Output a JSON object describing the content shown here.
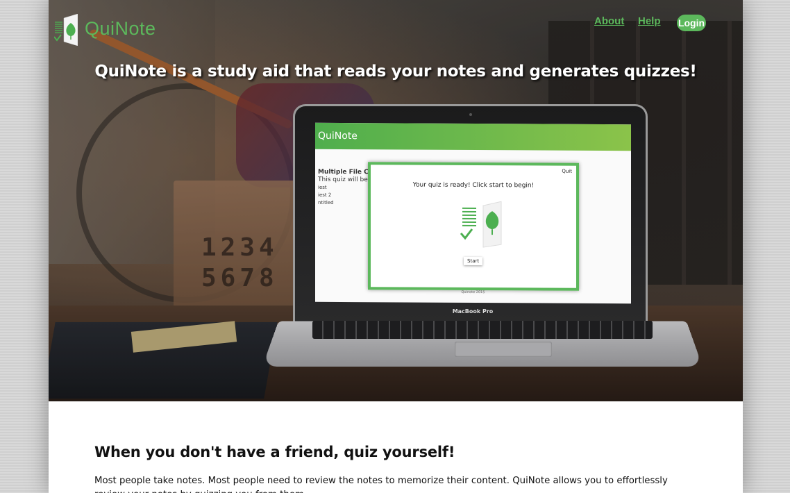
{
  "header": {
    "logo_text": "QuiNote",
    "nav": {
      "about": "About",
      "help": "Help",
      "login": "Login"
    }
  },
  "hero": {
    "headline": "QuiNote is a study aid that reads your notes and generates quizzes!",
    "crate_numbers": "1234\n5678",
    "laptop_brand": "MacBook Pro",
    "screen": {
      "app_title": "QuiNote",
      "left_text_1": "Multiple File C",
      "left_text_2": "This quiz will be",
      "left_text_3": "iest",
      "left_text_4": "iest 2",
      "left_text_5": "ntitled",
      "modal_quit": "Quit",
      "modal_message": "Your quiz is ready! Click start to begin!",
      "modal_start": "Start",
      "footer": "Quinote 2015"
    }
  },
  "section": {
    "title": "When you don't have a friend, quiz yourself!",
    "body": "Most people take notes. Most people need to review the notes to memorize their content. QuiNote allows you to effortlessly review your notes by quizzing you from them."
  },
  "colors": {
    "brand_green": "#5cb85c"
  }
}
